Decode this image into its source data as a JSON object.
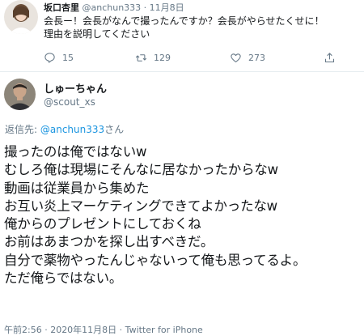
{
  "reply_tweet": {
    "name": "坂口杏里",
    "handle": "@anchun333",
    "separator": "·",
    "date": "11月8日",
    "text_lines": [
      "会長ー！会長がなんで撮ったんですか？会長がやらせたくせに！",
      "理由を説明してください"
    ],
    "reply_count": "15",
    "retweet_count": "129",
    "like_count": "273"
  },
  "main_tweet": {
    "name": "しゅーちゃん",
    "handle": "@scout_xs",
    "replying_prefix": "返信先:",
    "replying_to": "@anchun333",
    "replying_suffix": "さん",
    "lines": [
      "撮ったのは俺ではないw",
      "むしろ俺は現場にそんなに居なかったからなw",
      "動画は従業員から集めた",
      "お互い炎上マーケティングできてよかったなw",
      "俺からのプレゼントにしておくね",
      "お前はあまつかを探し出すべきだ。",
      "自分で薬物やったんじゃないって俺も思ってるよ。",
      "ただ俺らではない。"
    ],
    "timestamp": "午前2:56 · 2020年11月8日 · Twitter for iPhone"
  },
  "icons": {
    "reply": "reply-icon",
    "retweet": "retweet-icon",
    "like": "heart-icon",
    "share": "share-icon"
  },
  "colors": {
    "text": "#14171a",
    "muted": "#657786",
    "link": "#1b95e0",
    "divider": "#e6ecf0"
  }
}
